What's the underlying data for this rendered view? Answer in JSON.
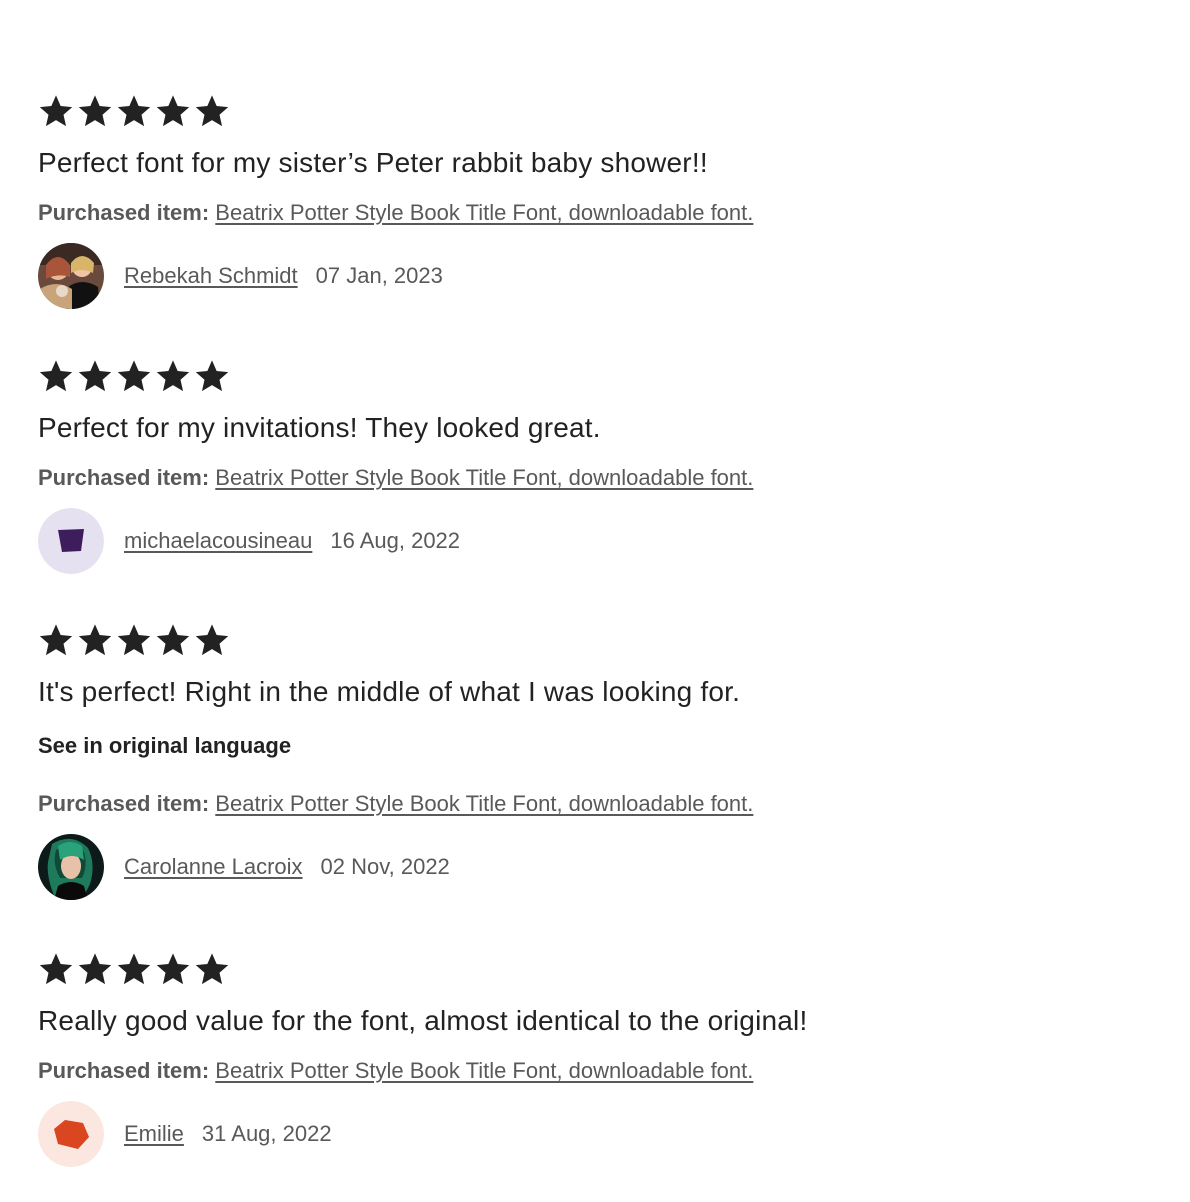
{
  "reviews": [
    {
      "rating": 5,
      "text": "Perfect font for my sister’s Peter rabbit baby shower!!",
      "purchased_label": "Purchased item:",
      "purchased_item": "Beatrix Potter Style Book Title Font, downloadable font.",
      "reviewer": "Rebekah Schmidt",
      "date": "07 Jan, 2023"
    },
    {
      "rating": 5,
      "text": "Perfect for my invitations! They looked great.",
      "purchased_label": "Purchased item:",
      "purchased_item": "Beatrix Potter Style Book Title Font, downloadable font.",
      "reviewer": "michaelacousineau",
      "date": "16 Aug, 2022",
      "avatar_bg": "#e6e1f0",
      "avatar_shape_color": "#3d1d5c"
    },
    {
      "rating": 5,
      "text": "It's perfect! Right in the middle of what I was looking for.",
      "see_original": "See in original language",
      "purchased_label": "Purchased item:",
      "purchased_item": "Beatrix Potter Style Book Title Font, downloadable font.",
      "reviewer": "Carolanne Lacroix",
      "date": "02 Nov, 2022"
    },
    {
      "rating": 5,
      "text": "Really good value for the font, almost identical to the original!",
      "purchased_label": "Purchased item:",
      "purchased_item": "Beatrix Potter Style Book Title Font, downloadable font.",
      "reviewer": "Emilie",
      "date": "31 Aug, 2022",
      "avatar_bg": "#fbe6e0",
      "avatar_shape_color": "#d9461f"
    }
  ],
  "colors": {
    "star": "#222222",
    "text": "#222222",
    "muted": "#595959"
  },
  "icons": {
    "star": "star-icon"
  }
}
